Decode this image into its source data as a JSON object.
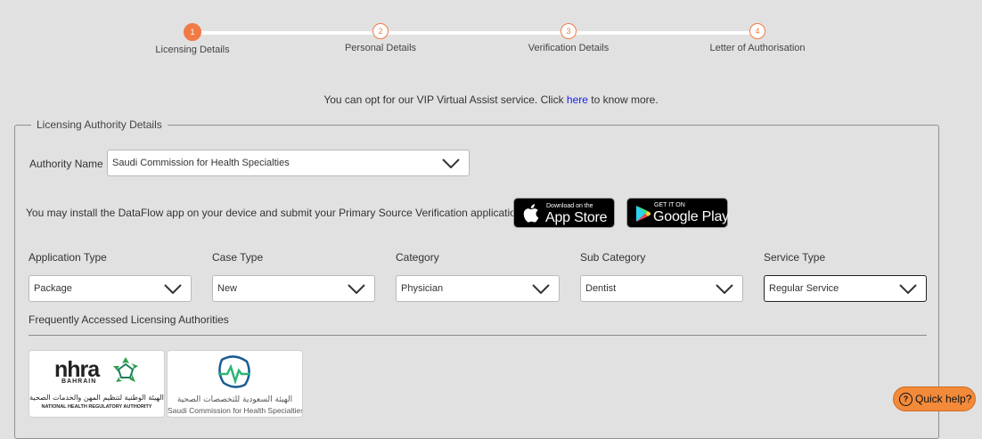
{
  "stepper": {
    "steps": [
      {
        "number": "1",
        "label": "Licensing Details"
      },
      {
        "number": "2",
        "label": "Personal Details"
      },
      {
        "number": "3",
        "label": "Verification Details"
      },
      {
        "number": "4",
        "label": "Letter of Authorisation"
      }
    ],
    "active_step": 1
  },
  "vip": {
    "text_before": "You can opt for our VIP Virtual Assist service. Click ",
    "link": "here",
    "text_after": " to know more."
  },
  "licensing": {
    "legend": "Licensing Authority Details",
    "authority_label": "Authority Name",
    "authority_value": "Saudi Commission for Health Specialties"
  },
  "app_promo": {
    "text": "You may install the DataFlow app on your device and submit your Primary Source Verification application with it.",
    "app_store_small": "Download on the",
    "app_store_big": "App Store",
    "google_play_small": "GET IT ON",
    "google_play_big": "Google Play"
  },
  "fields": [
    {
      "label": "Application Type",
      "value": "Package"
    },
    {
      "label": "Case Type",
      "value": "New"
    },
    {
      "label": "Category",
      "value": "Physician"
    },
    {
      "label": "Sub Category",
      "value": "Dentist"
    },
    {
      "label": "Service Type",
      "value": "Regular Service"
    }
  ],
  "frequent": {
    "label": "Frequently Accessed Licensing Authorities",
    "nhra": {
      "name": "nhra",
      "sub": "BAHRAIN",
      "arabic": "الهيئة الوطنية لتنظيم المهن والخدمات الصحية",
      "english": "NATIONAL HEALTH REGULATORY AUTHORITY"
    },
    "scfhs": {
      "arabic": "الهيئة السعودية للتخصصات الصحية",
      "english": "Saudi Commission for Health Specialties"
    }
  },
  "quick_help": {
    "icon": "?",
    "label": "Quick help?"
  },
  "colors": {
    "accent": "#f07b45",
    "link": "#1a22e6",
    "quick_help": "#f28a3a"
  }
}
